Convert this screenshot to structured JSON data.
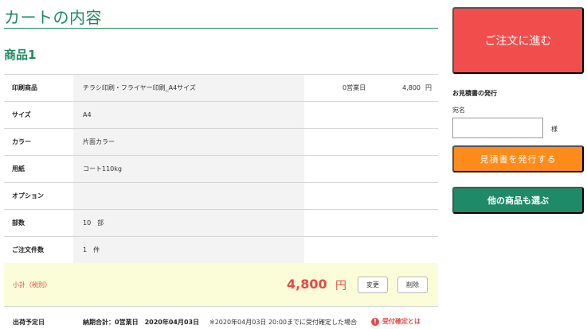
{
  "page": {
    "title": "カートの内容",
    "product_heading": "商品1"
  },
  "spec_rows": [
    {
      "label": "印刷商品",
      "value": "チラシ印刷・フライヤー印刷_A4サイズ",
      "business_days": "0営業日",
      "price": "4,800",
      "yen": "円"
    },
    {
      "label": "サイズ",
      "value": "A4"
    },
    {
      "label": "カラー",
      "value": "片面カラー"
    },
    {
      "label": "用紙",
      "value": "コート110kg"
    },
    {
      "label": "オプション",
      "value": ""
    },
    {
      "label": "部数",
      "value": "10　部"
    },
    {
      "label": "ご注文件数",
      "value": "1　件"
    }
  ],
  "subtotal": {
    "label": "小計（税別）",
    "amount": "4,800",
    "yen": "円",
    "change_label": "変更",
    "delete_label": "削除"
  },
  "shipping": {
    "label": "出荷予定日",
    "detail": "納期合計：0営業日　2020年04月03日",
    "note": "※2020年04月03日 20:00までに受付確定した場合",
    "link": "受付確定とは",
    "link_icon": "alert-circle-icon"
  },
  "sidebar": {
    "order_button": "ご注文に進む",
    "estimate_title": "お見積書の発行",
    "addressee_label": "宛名",
    "addressee_value": "",
    "honorific": "様",
    "estimate_button": "見積書を発行する",
    "other_products_button": "他の商品も選ぶ"
  },
  "colors": {
    "brand_green": "#1e8a5e",
    "order_red": "#f24d4d",
    "estimate_orange": "#ff8c1a",
    "other_green": "#1e8a67",
    "price_red": "#e24a4a",
    "subtotal_bg": "#fbfcd8"
  }
}
